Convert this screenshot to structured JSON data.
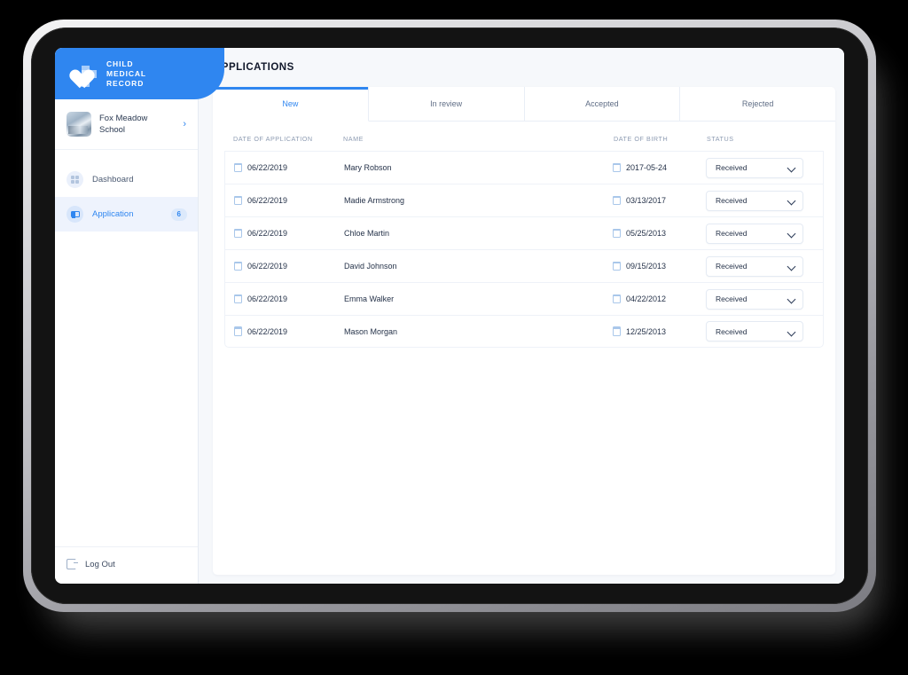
{
  "brand": {
    "line1": "CHILD",
    "line2": "MEDICAL",
    "line3": "RECORD",
    "accent_color": "#2f86f0"
  },
  "sidebar": {
    "school": {
      "name": "Fox Meadow School",
      "chevron": "›"
    },
    "items": [
      {
        "label": "Dashboard",
        "icon": "grid-icon",
        "active": false,
        "badge": ""
      },
      {
        "label": "Application",
        "icon": "application-icon",
        "active": true,
        "badge": "6"
      }
    ],
    "logout": {
      "label": "Log Out",
      "icon": "logout-icon"
    }
  },
  "header": {
    "title": "APPLICATIONS"
  },
  "tabs": [
    {
      "label": "New",
      "active": true
    },
    {
      "label": "In review",
      "active": false
    },
    {
      "label": "Accepted",
      "active": false
    },
    {
      "label": "Rejected",
      "active": false
    }
  ],
  "table": {
    "columns": {
      "date_of_application": "DATE OF APPLICATION",
      "name": "NAME",
      "date_of_birth": "DATE OF BIRTH",
      "status": "STATUS"
    },
    "rows": [
      {
        "date_of_application": "06/22/2019",
        "name": "Mary Robson",
        "date_of_birth": "2017-05-24",
        "status": "Received"
      },
      {
        "date_of_application": "06/22/2019",
        "name": "Madie Armstrong",
        "date_of_birth": "03/13/2017",
        "status": "Received"
      },
      {
        "date_of_application": "06/22/2019",
        "name": "Chloe Martin",
        "date_of_birth": "05/25/2013",
        "status": "Received"
      },
      {
        "date_of_application": "06/22/2019",
        "name": "David Johnson",
        "date_of_birth": "09/15/2013",
        "status": "Received"
      },
      {
        "date_of_application": "06/22/2019",
        "name": "Emma Walker",
        "date_of_birth": "04/22/2012",
        "status": "Received"
      },
      {
        "date_of_application": "06/22/2019",
        "name": "Mason Morgan",
        "date_of_birth": "12/25/2013",
        "status": "Received"
      }
    ]
  }
}
